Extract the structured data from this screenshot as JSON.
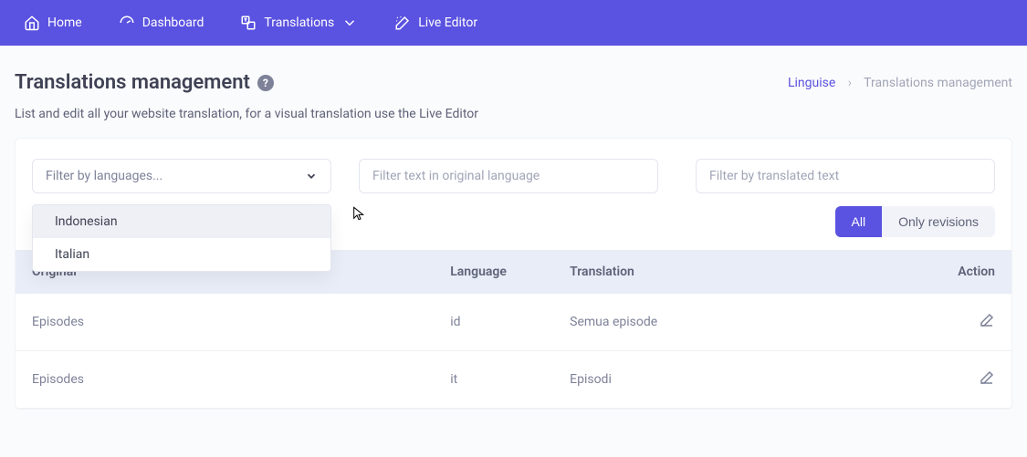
{
  "nav": {
    "home": "Home",
    "dashboard": "Dashboard",
    "translations": "Translations",
    "live_editor": "Live Editor"
  },
  "page": {
    "title": "Translations management",
    "subtitle": "List and edit all your website translation, for a visual translation use the Live Editor"
  },
  "breadcrumb": {
    "root": "Linguise",
    "current": "Translations management"
  },
  "filters": {
    "lang_placeholder": "Filter by languages...",
    "lang_options": [
      "Indonesian",
      "Italian"
    ],
    "original_placeholder": "Filter text in original language",
    "translated_placeholder": "Filter by translated text"
  },
  "toggle": {
    "all": "All",
    "revisions": "Only revisions"
  },
  "table": {
    "headers": {
      "original": "Original",
      "language": "Language",
      "translation": "Translation",
      "action": "Action"
    },
    "rows": [
      {
        "original": "Episodes",
        "language": "id",
        "translation": "Semua episode"
      },
      {
        "original": "Episodes",
        "language": "it",
        "translation": "Episodi"
      }
    ]
  }
}
